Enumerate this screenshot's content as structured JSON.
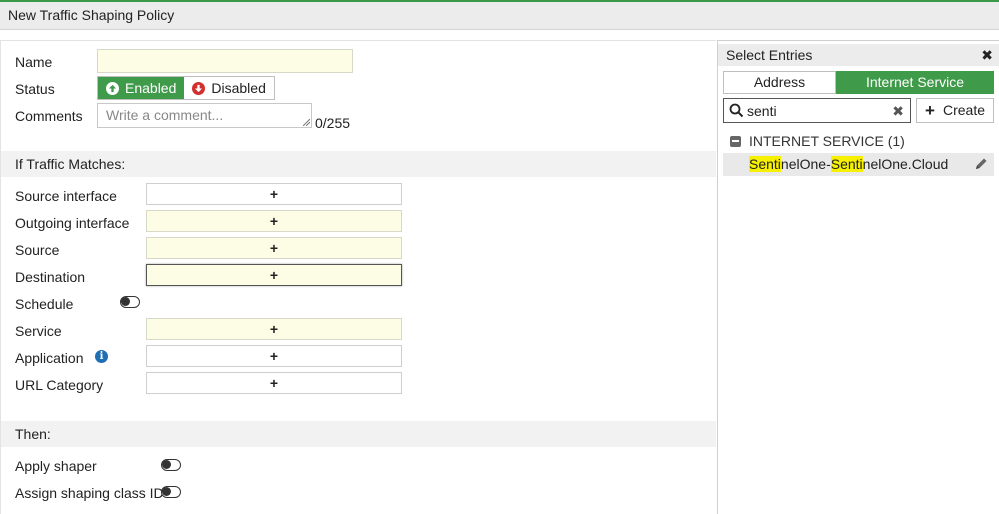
{
  "window": {
    "title": "New Traffic Shaping Policy"
  },
  "form": {
    "name_label": "Name",
    "name_value": "",
    "status_label": "Status",
    "status_enabled": "Enabled",
    "status_disabled": "Disabled",
    "comments_label": "Comments",
    "comments_placeholder": "Write a comment...",
    "comments_counter": "0/255",
    "section_matches": "If Traffic Matches:",
    "rows": {
      "source_interface": "Source interface",
      "outgoing_interface": "Outgoing interface",
      "source": "Source",
      "destination": "Destination",
      "schedule": "Schedule",
      "service": "Service",
      "application": "Application",
      "url_category": "URL Category"
    },
    "add_glyph": "+",
    "section_then": "Then:",
    "apply_shaper": "Apply shaper",
    "assign_class": "Assign shaping class ID"
  },
  "panel": {
    "title": "Select Entries",
    "tabs": {
      "address": "Address",
      "internet_service": "Internet Service"
    },
    "search_value": "senti",
    "create_label": "Create",
    "group_label": "INTERNET SERVICE (1)",
    "entry": {
      "part1": "Senti",
      "part2": "nelOne-",
      "part3": "Senti",
      "part4": "nelOne.Cloud"
    }
  },
  "colors": {
    "accent_green": "#3f9a4a",
    "highlight": "#f7f000",
    "field_yellow": "#fdfde6"
  },
  "icons": [
    "arrow-up-circle-icon",
    "arrow-down-circle-icon",
    "info-icon",
    "close-icon",
    "search-icon",
    "clear-icon",
    "plus-icon",
    "minus-icon",
    "pencil-icon"
  ]
}
